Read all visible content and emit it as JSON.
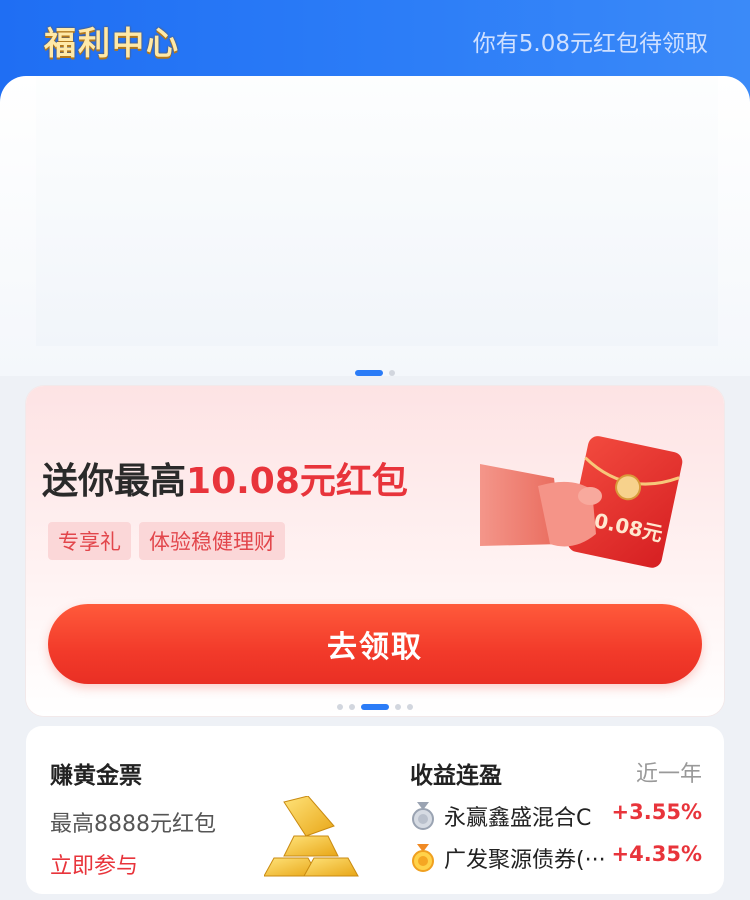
{
  "header": {
    "title": "福利中心",
    "subtitle": "你有5.08元红包待领取"
  },
  "promo": {
    "title_prefix": "送你最高",
    "title_highlight": "10.08元红包",
    "tags": [
      "专享礼",
      "体验稳健理财"
    ],
    "envelope_amount": "10.08元",
    "cta_label": "去领取"
  },
  "gold_card": {
    "title": "赚黄金票",
    "desc": "最高8888元红包",
    "link": "立即参与"
  },
  "returns_card": {
    "title": "收益连盈",
    "period": "近一年",
    "funds": [
      {
        "name": "永赢鑫盛混合C",
        "rate": "+3.55%",
        "medal": "silver"
      },
      {
        "name": "广发聚源债券(···",
        "rate": "+4.35%",
        "medal": "gold"
      }
    ]
  },
  "colors": {
    "header_blue": "#2b7cf7",
    "accent_red": "#e8343b",
    "title_gold": "#ffe9a8"
  }
}
